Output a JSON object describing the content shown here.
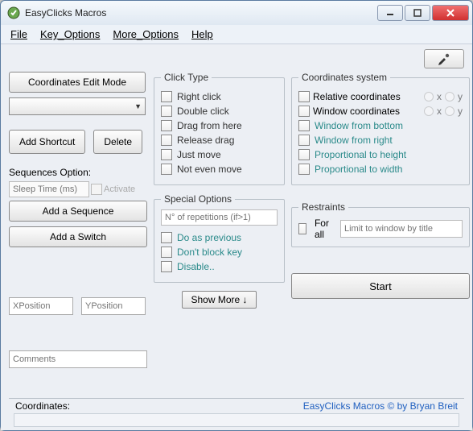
{
  "window": {
    "title": "EasyClicks Macros"
  },
  "menubar": {
    "file": "File",
    "key_options": "Key_Options",
    "more_options": "More_Options",
    "help": "Help"
  },
  "toolbar": {
    "coordinates_edit_mode": "Coordinates Edit Mode",
    "add_shortcut": "Add Shortcut",
    "delete": "Delete"
  },
  "sequences": {
    "label": "Sequences Option:",
    "sleep_placeholder": "Sleep Time (ms)",
    "activate": "Activate",
    "add_sequence": "Add a Sequence",
    "add_switch": "Add a Switch"
  },
  "position": {
    "x_placeholder": "XPosition",
    "y_placeholder": "YPosition"
  },
  "comments_placeholder": "Comments",
  "click_type": {
    "legend": "Click Type",
    "right_click": "Right click",
    "double_click": "Double click",
    "drag_from_here": "Drag from here",
    "release_drag": "Release drag",
    "just_move": "Just move",
    "not_even_move": "Not even move"
  },
  "special": {
    "legend": "Special Options",
    "reps_placeholder": "N° of repetitions (if>1)",
    "do_as_previous": "Do as previous",
    "dont_block_key": "Don't block key",
    "disable": "Disable.."
  },
  "show_more": "Show More ↓",
  "coord_system": {
    "legend": "Coordinates system",
    "relative": "Relative coordinates",
    "window": "Window coordinates",
    "from_bottom": "Window from bottom",
    "from_right": "Window from right",
    "prop_height": "Proportional to height",
    "prop_width": "Proportional to width",
    "x": "x",
    "y": "y"
  },
  "restraints": {
    "legend": "Restraints",
    "for_all": "For all",
    "limit_placeholder": "Limit to window by title"
  },
  "start": "Start",
  "status": {
    "coordinates_label": "Coordinates:",
    "credit": "EasyClicks Macros © by Bryan Breit"
  }
}
